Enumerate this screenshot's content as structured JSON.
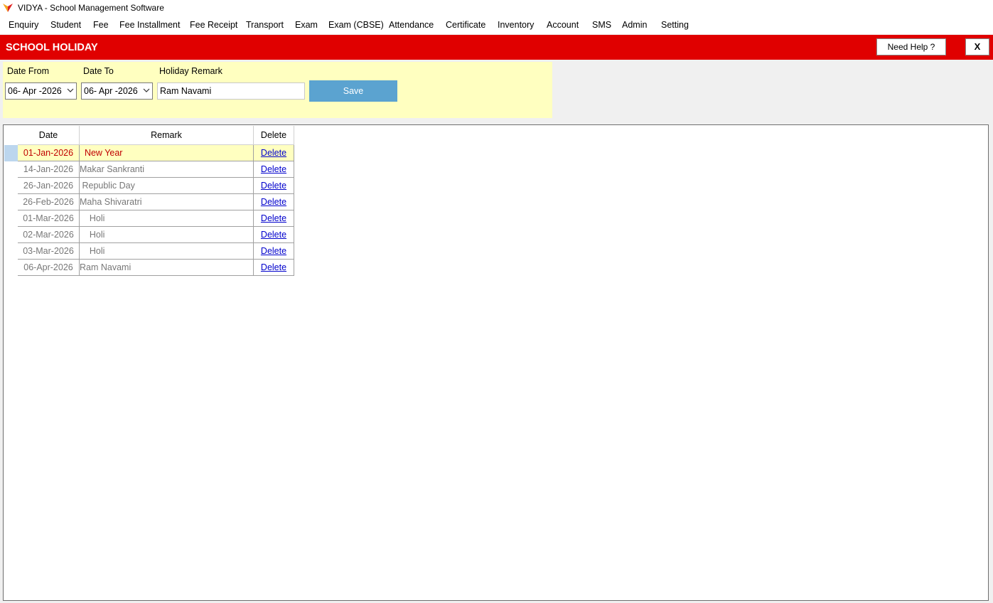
{
  "window": {
    "title": "VIDYA - School Management Software",
    "logo_icon": "vidya-logo-icon",
    "logo_colors": [
      "#f5a623",
      "#e02020"
    ]
  },
  "menu": [
    "Enquiry",
    "Student",
    "Fee",
    "Fee Installment",
    "Fee Receipt",
    "Transport",
    "Exam",
    "Exam (CBSE)",
    "Attendance",
    "Certificate",
    "Inventory",
    "Account",
    "SMS",
    "Admin",
    "Setting"
  ],
  "header": {
    "title": "SCHOOL HOLIDAY",
    "help_label": "Need Help ?",
    "close_label": "X",
    "background_color": "#e00000"
  },
  "form": {
    "date_from_label": "Date From",
    "date_to_label": "Date To",
    "remark_label": "Holiday Remark",
    "date_from_value": "06- Apr -2026",
    "date_to_value": "06- Apr -2026",
    "remark_value": "Ram Navami",
    "save_label": "Save",
    "panel_color": "#ffffc0",
    "save_color": "#5ba3d0"
  },
  "grid": {
    "columns": [
      "Date",
      "Remark",
      "Delete"
    ],
    "rows": [
      {
        "date": "01-Jan-2026",
        "remark": "  New Year",
        "delete": "Delete",
        "selected": true
      },
      {
        "date": "14-Jan-2026",
        "remark": "Makar Sankranti",
        "delete": "Delete"
      },
      {
        "date": "26-Jan-2026",
        "remark": " Republic Day",
        "delete": "Delete"
      },
      {
        "date": "26-Feb-2026",
        "remark": "Maha Shivaratri",
        "delete": "Delete"
      },
      {
        "date": "01-Mar-2026",
        "remark": "    Holi",
        "delete": "Delete"
      },
      {
        "date": "02-Mar-2026",
        "remark": "    Holi",
        "delete": "Delete"
      },
      {
        "date": "03-Mar-2026",
        "remark": "    Holi",
        "delete": "Delete"
      },
      {
        "date": "06-Apr-2026",
        "remark": "Ram Navami",
        "delete": "Delete"
      }
    ],
    "selected_row_color": "#ffffc0",
    "selected_text_color": "#c00000",
    "link_color": "#0000cc"
  }
}
